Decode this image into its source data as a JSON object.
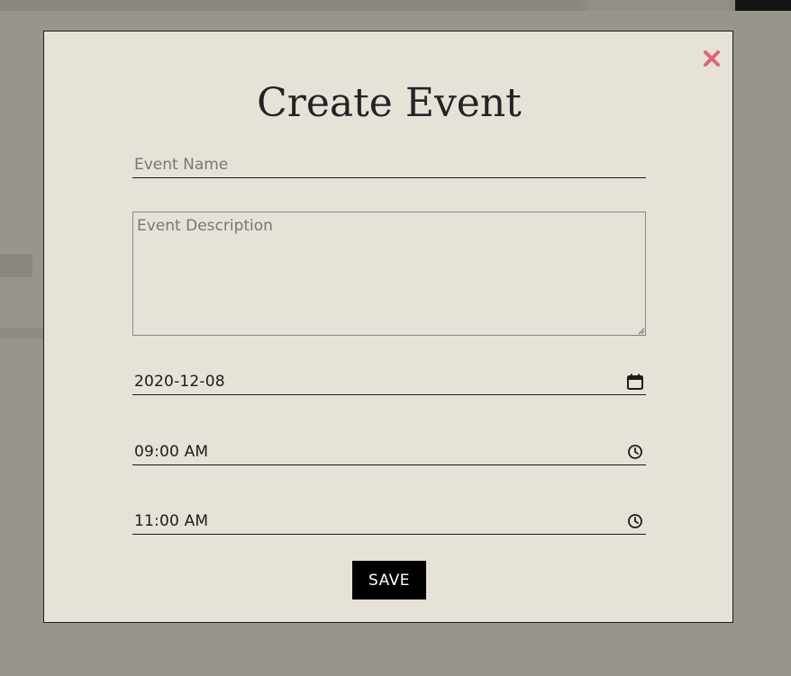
{
  "modal": {
    "title": "Create Event",
    "close_icon": "close-x-icon",
    "close_color": "#e06673",
    "fields": {
      "name_placeholder": "Event Name",
      "description_placeholder": "Event Description",
      "date_value": "2020-12-08",
      "date_icon": "calendar-icon",
      "start_time_value": "09:00 AM",
      "end_time_value": "11:00 AM",
      "time_icon": "clock-icon"
    },
    "save_label": "SAVE"
  },
  "colors": {
    "overlay": "#98958e",
    "modal_background": "#e6e2d7",
    "button_background": "#000000",
    "text": "#222326"
  }
}
